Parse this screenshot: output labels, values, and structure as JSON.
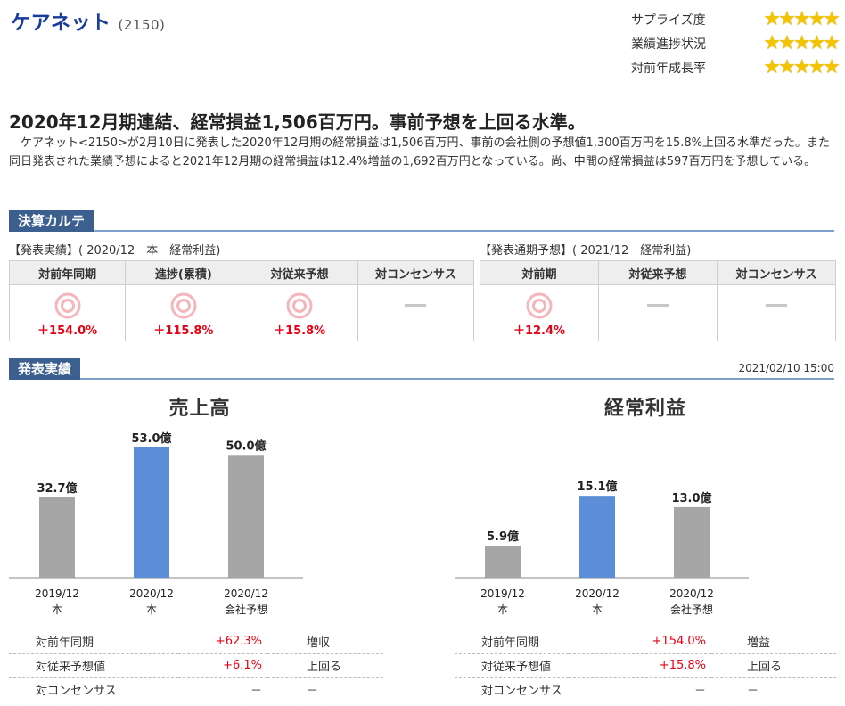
{
  "header": {
    "company_name": "ケアネット",
    "company_code": "(2150)"
  },
  "ratings": [
    {
      "label": "サプライズ度",
      "stars": "★★★★★",
      "count": 5
    },
    {
      "label": "業績進捗状況",
      "stars": "★★★★★",
      "count": 5
    },
    {
      "label": "対前年成長率",
      "stars": "★★★★★",
      "count": 5
    }
  ],
  "article": {
    "headline": "2020年12月期連結、経常損益1,506百万円。事前予想を上回る水準。",
    "body": "ケアネット<2150>が2月10日に発表した2020年12月期の経常損益は1,506百万円、事前の会社側の予想値1,300百万円を15.8%上回る水準だった。また同日発表された業績予想によると2021年12月期の経常損益は12.4%増益の1,692百万円となっている。尚、中間の経常損益は597百万円を予想している。"
  },
  "karte": {
    "section_title": "決算カルテ",
    "results_label": "【発表実績】( 2020/12　本　経常利益)",
    "forecast_label": "【発表通期予想】( 2021/12　経常利益)",
    "results_columns": [
      {
        "header": "対前年同期",
        "mark": "double-circle",
        "value": "＋154.0%"
      },
      {
        "header": "進捗(累積)",
        "mark": "double-circle",
        "value": "＋115.8%"
      },
      {
        "header": "対従来予想",
        "mark": "double-circle",
        "value": "＋15.8%"
      },
      {
        "header": "対コンセンサス",
        "mark": "dash",
        "value": ""
      }
    ],
    "forecast_columns": [
      {
        "header": "対前期",
        "mark": "double-circle",
        "value": "＋12.4%"
      },
      {
        "header": "対従来予想",
        "mark": "dash",
        "value": ""
      },
      {
        "header": "対コンセンサス",
        "mark": "dash",
        "value": ""
      }
    ]
  },
  "results": {
    "section_title": "発表実績",
    "timestamp": "2021/02/10 15:00"
  },
  "colors": {
    "actual_bar": "#5b8ed6",
    "other_bar": "#a6a6a6",
    "positive": "#e60012",
    "section_tab": "#3b5f8e",
    "star": "#f3c400"
  },
  "chart_data": [
    {
      "type": "bar",
      "title": "売上高",
      "unit": "億",
      "categories": [
        "2019/12 本",
        "2020/12 本",
        "2020/12 会社予想"
      ],
      "category_lines": [
        [
          "2019/12",
          "本"
        ],
        [
          "2020/12",
          "本"
        ],
        [
          "2020/12",
          "会社予想"
        ]
      ],
      "values": [
        32.7,
        53.0,
        50.0
      ],
      "value_labels": [
        "32.7億",
        "53.0億",
        "50.0億"
      ],
      "highlight_index": 1,
      "ylim": [
        0,
        53.0
      ],
      "grid": false,
      "metrics": [
        {
          "label": "対前年同期",
          "value": "+62.3%",
          "eval": "増収",
          "positive": true
        },
        {
          "label": "対従来予想値",
          "value": "+6.1%",
          "eval": "上回る",
          "positive": true
        },
        {
          "label": "対コンセンサス",
          "value": "－",
          "eval": "－",
          "positive": false
        }
      ]
    },
    {
      "type": "bar",
      "title": "経常利益",
      "unit": "億",
      "categories": [
        "2019/12 本",
        "2020/12 本",
        "2020/12 会社予想"
      ],
      "category_lines": [
        [
          "2019/12",
          "本"
        ],
        [
          "2020/12",
          "本"
        ],
        [
          "2020/12",
          "会社予想"
        ]
      ],
      "values": [
        5.9,
        15.1,
        13.0
      ],
      "value_labels": [
        "5.9億",
        "15.1億",
        "13.0億"
      ],
      "highlight_index": 1,
      "ylim": [
        0,
        24.0
      ],
      "grid": false,
      "metrics": [
        {
          "label": "対前年同期",
          "value": "+154.0%",
          "eval": "増益",
          "positive": true
        },
        {
          "label": "対従来予想値",
          "value": "+15.8%",
          "eval": "上回る",
          "positive": true
        },
        {
          "label": "対コンセンサス",
          "value": "－",
          "eval": "－",
          "positive": false
        }
      ]
    }
  ]
}
